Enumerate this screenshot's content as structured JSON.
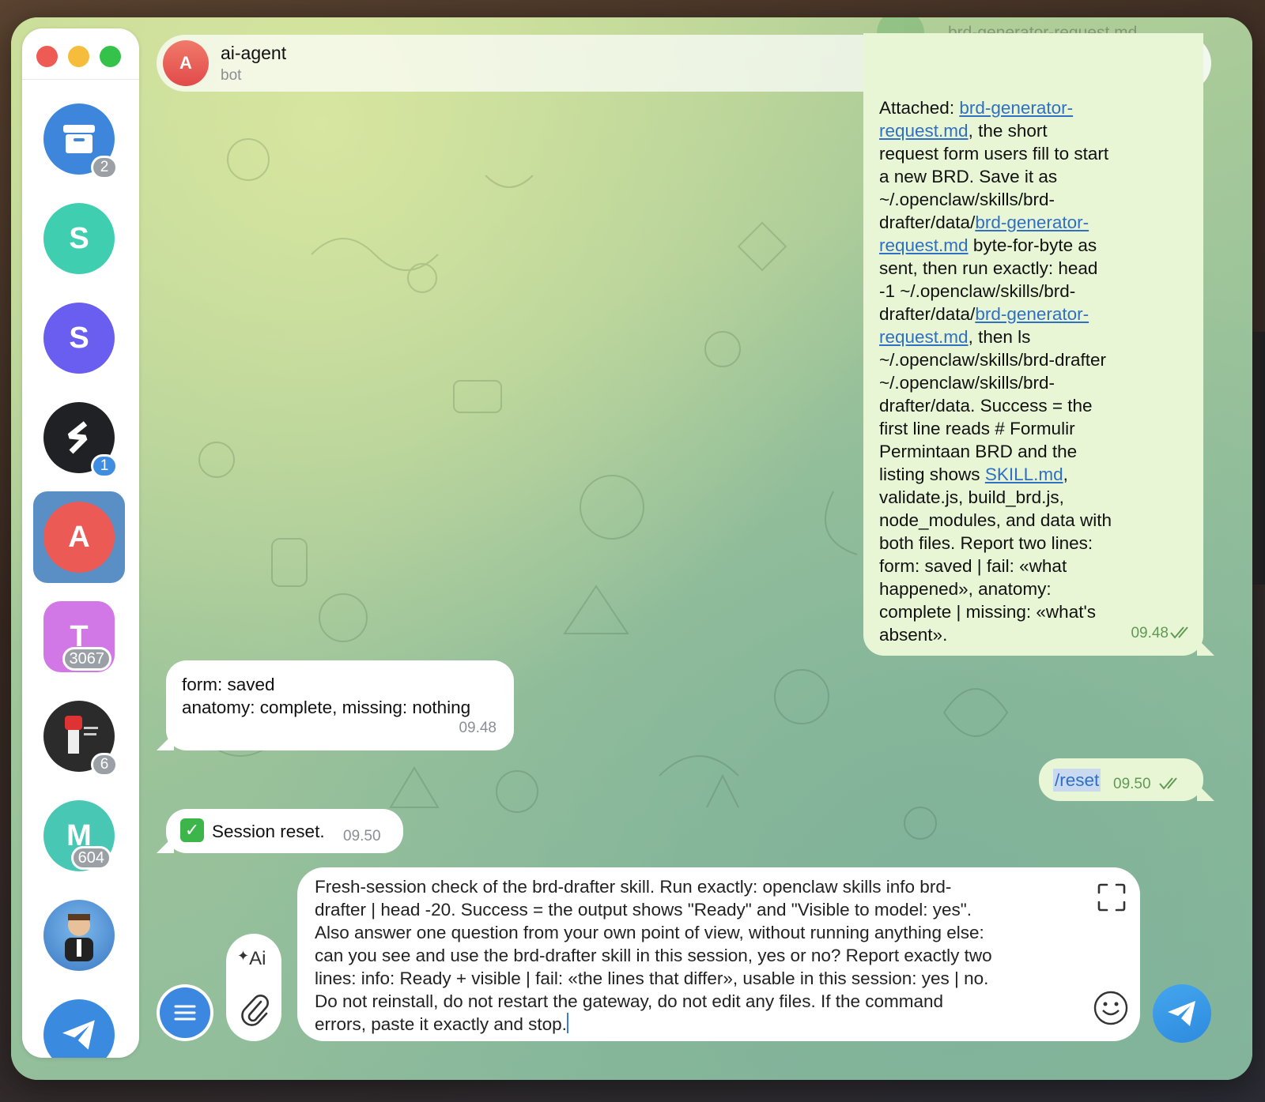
{
  "sidebar": {
    "chats": [
      {
        "name": "Archived",
        "initial": "",
        "badge": "2",
        "color": "#3d86dc",
        "icon": "archive-icon"
      },
      {
        "name": "S",
        "initial": "S",
        "badge": "",
        "color": "#3fcfb0"
      },
      {
        "name": "S",
        "initial": "S",
        "badge": "",
        "color": "#6a5ef0"
      },
      {
        "name": "S",
        "initial": "",
        "badge": "1",
        "color": "#202124",
        "icon": "s-logo-icon"
      },
      {
        "name": "ai-agent",
        "initial": "A",
        "badge": "",
        "color": "#ec5a55",
        "active": true
      },
      {
        "name": "T",
        "initial": "T",
        "badge": "3067",
        "color": "#d277e6"
      },
      {
        "name": "Group",
        "initial": "",
        "badge": "6",
        "color": "#2b2b2b",
        "icon": "fist-image"
      },
      {
        "name": "M",
        "initial": "M",
        "badge": "604",
        "color": "#48c8b4"
      },
      {
        "name": "Cartoon",
        "initial": "",
        "badge": "",
        "color": "#3c8fd8",
        "icon": "cartoon-avatar"
      },
      {
        "name": "Telegram",
        "initial": "",
        "badge": "",
        "color": "#3a8be0",
        "icon": "telegram-icon"
      }
    ]
  },
  "header": {
    "avatar_initial": "A",
    "title": "ai-agent",
    "subtitle": "bot",
    "ghost_file": "brd-generator-request.md"
  },
  "messages": {
    "long_out": {
      "lines": [
        [
          {
            "t": "Attached: "
          },
          {
            "t": "brd-generator-",
            "link": true
          }
        ],
        [
          {
            "t": "request.md",
            "link": true
          },
          {
            "t": ", the short"
          }
        ],
        [
          {
            "t": "request form users fill to start"
          }
        ],
        [
          {
            "t": "a new BRD. Save it as"
          }
        ],
        [
          {
            "t": "~/.openclaw/skills/brd-"
          }
        ],
        [
          {
            "t": "drafter/data/"
          },
          {
            "t": "brd-generator-",
            "link": true
          }
        ],
        [
          {
            "t": "request.md",
            "link": true
          },
          {
            "t": " byte-for-byte as"
          }
        ],
        [
          {
            "t": "sent, then run exactly: head"
          }
        ],
        [
          {
            "t": "-1 ~/.openclaw/skills/brd-"
          }
        ],
        [
          {
            "t": "drafter/data/"
          },
          {
            "t": "brd-generator-",
            "link": true
          }
        ],
        [
          {
            "t": "request.md",
            "link": true
          },
          {
            "t": ", then ls"
          }
        ],
        [
          {
            "t": "~/.openclaw/skills/brd-drafter"
          }
        ],
        [
          {
            "t": "~/.openclaw/skills/brd-"
          }
        ],
        [
          {
            "t": "drafter/data. Success = the"
          }
        ],
        [
          {
            "t": "first line reads # Formulir"
          }
        ],
        [
          {
            "t": "Permintaan BRD and the"
          }
        ],
        [
          {
            "t": "listing shows "
          },
          {
            "t": "SKILL.md",
            "link": true
          },
          {
            "t": ","
          }
        ],
        [
          {
            "t": "validate.js, build_brd.js,"
          }
        ],
        [
          {
            "t": "node_modules, and data with"
          }
        ],
        [
          {
            "t": "both files. Report two lines:"
          }
        ],
        [
          {
            "t": "form: saved | fail: «what"
          }
        ],
        [
          {
            "t": "happened», anatomy:"
          }
        ],
        [
          {
            "t": "complete | missing: «what's"
          }
        ],
        [
          {
            "t": "absent»."
          }
        ]
      ],
      "time": "09.48"
    },
    "reply_1": {
      "line1": "form: saved",
      "line2": "anatomy: complete, missing: nothing",
      "time": "09.48"
    },
    "reset_out": {
      "text": "/reset",
      "time": "09.50"
    },
    "reset_in": {
      "emoji": "✅",
      "text": "Session reset.",
      "time": "09.50"
    }
  },
  "composer": {
    "lines": [
      "Fresh-session check of the brd-drafter skill. Run exactly: openclaw skills info brd-",
      "drafter | head -20. Success = the output shows \"Ready\" and \"Visible to model: yes\".",
      "Also answer one question from your own point of view, without running anything else:",
      "can you see and use the brd-drafter skill in this session, yes or no? Report exactly two",
      "lines: info: Ready + visible | fail: «the lines that differ», usable in this session: yes | no.",
      "Do not reinstall, do not restart the gateway, do not edit any files. If the command",
      "errors, paste it exactly and stop."
    ],
    "ai_label": "Ai"
  },
  "colors": {
    "accent": "#3c87e0",
    "outgoing_bubble": "#e8f6d6",
    "incoming_bubble": "#ffffff",
    "link": "#2f6fc4"
  }
}
